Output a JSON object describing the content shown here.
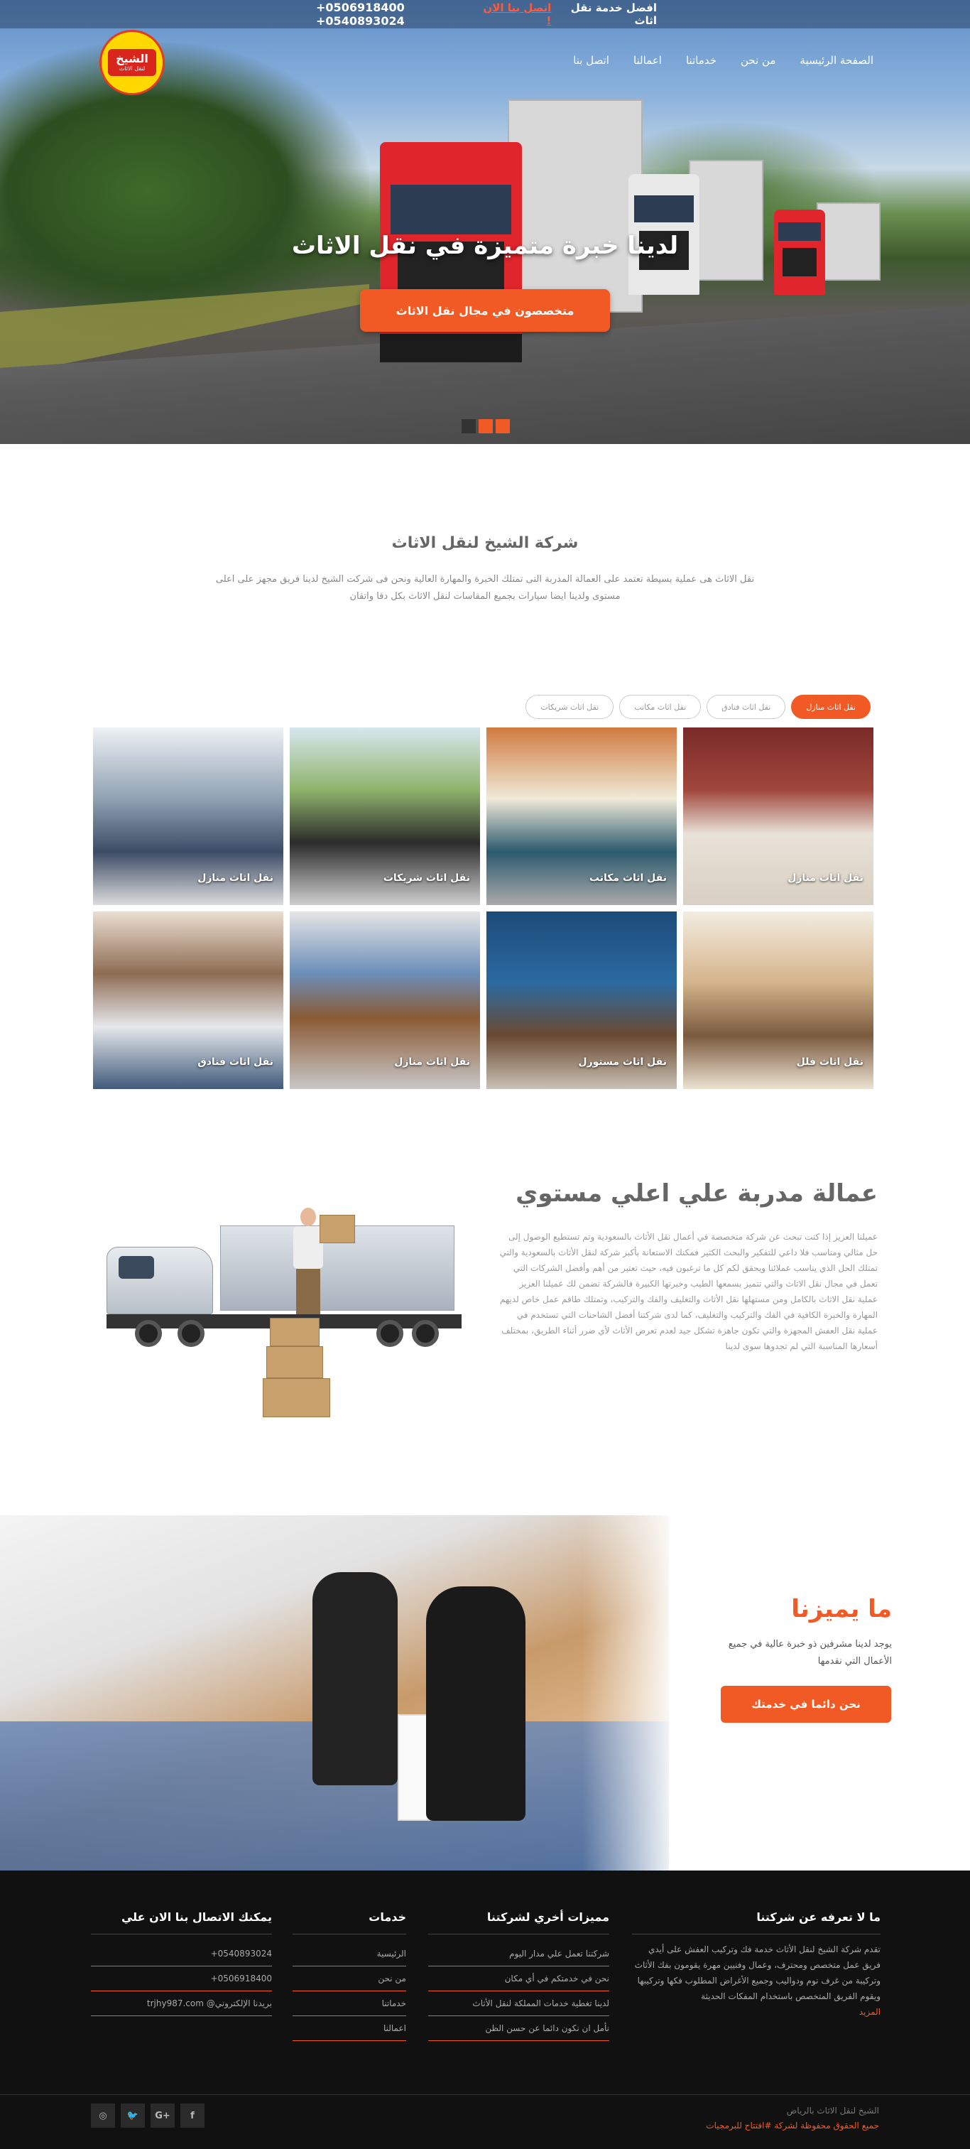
{
  "topbar": {
    "slogan": "افضل خدمة نقل اثاث",
    "call_label": "اتصل بنا الان !",
    "phones": "+0506918400 +0540893024"
  },
  "brand": {
    "name": "الشيخ",
    "subtitle": "لنقل الاثاث"
  },
  "nav": [
    {
      "label": "الصفحة الرئيسية"
    },
    {
      "label": "من نحن"
    },
    {
      "label": "خدماتنا"
    },
    {
      "label": "اعمالنا"
    },
    {
      "label": "اتصل بنا"
    }
  ],
  "hero": {
    "title": "لدينا خبرة متميزة في نقل الاثاث",
    "button": "متخصصون في مجال نقل الاثاث",
    "slides": 3,
    "active_slide": 1
  },
  "intro": {
    "title": "شركة الشيخ لنقل الاثاث",
    "text": "نقل الاثاث هى عملية بسيطة تعتمد على العمالة المدربة التى تمتلك الخبرة والمهارة العالية ونحن فى شركت الشيخ لدينا فريق مجهز على اعلى مستوى ولدينا ايضا سيارات بجميع المقاسات لنقل الاثاث بكل دقا واتقان"
  },
  "tabs": [
    {
      "label": "نقل اثاث منازل",
      "active": true
    },
    {
      "label": "نقل اثاث فنادق",
      "active": false
    },
    {
      "label": "نقل اثاث مكاتب",
      "active": false
    },
    {
      "label": "نقل اثاث شريكات",
      "active": false
    }
  ],
  "gallery": [
    {
      "caption": "نقل اثاث منازل"
    },
    {
      "caption": "نقل اثاث مكاتب"
    },
    {
      "caption": "نقل اثاث شريكات"
    },
    {
      "caption": "نقل اثاث منازل"
    },
    {
      "caption": "نقل اثاث فلل"
    },
    {
      "caption": "نقل اثاث مستورل"
    },
    {
      "caption": "نقل اثاث منازل"
    },
    {
      "caption": "نقل اثاث فنادق"
    }
  ],
  "workers": {
    "title": "عمالة مدربة علي اعلي مستوي",
    "text": "عميلنا العزيز إذا كنت تبحث عن شركة متخصصة في أعمال نقل الأثاث بالسعودية وتم تستطيع الوصول إلى حل مثالي ومناسب فلا داعي للتفكير والبحث الكثير فمكنك الاستعانة بأكبر شركة لنقل الأثاث بالسعودية والتي تمتلك الحل الذي يناسب عملائنا ويحقق لكم كل ما ترغبون فيه، حيث تعتبر من أهم وأفضل الشركات التي تعمل في مجال نقل الاثاث والتي تتميز بسمعها الطيب وخبرتها الكبيرة فالشركة تضمن لك عميلنا العزيز عملية نقل الاثاث بالكامل ومن مستهلها نقل الأثاث والتغليف والفك والتركيب، وتمتلك طاقم عمل خاص لديهم المهارة والخبرة الكافية في الفك والتركيب والتغليف، كما لدى شركتنا أفضل الشاحنات التي تستخدم في عملية نقل العفش المجهزة والتي تكون جاهزة تشكل جيد لعدم تعرض الأثاث لأي ضرر أثناء الطريق، بمختلف أسعارها المناسبة التي لم تجدوها سوى لدينا"
  },
  "features": {
    "title": "ما يميزنا",
    "text": "يوجد لدينا مشرفين ذو خبرة عالية في جميع الأعمال التي نقدمها",
    "button": "نحن دائما في خدمتك"
  },
  "footer": {
    "about": {
      "title": "ما لا تعرفه عن شركتنا",
      "text": "تقدم شركة الشيخ لنقل الأثاث خدمة فك وتركيب العفش على أيدي فريق عمل متخصص ومحترف، وعمال وفنيين مهرة يقومون بفك الأثاث وتركيبة من غرف نوم ودواليب وجميع الأغراض المطلوب فكها وتركيبها ويقوم الفريق المتخصص باستخدام المفكات الحديثة",
      "more": "المزيد"
    },
    "features": {
      "title": "مميزات أخري لشركتنا",
      "items": [
        "شركتنا تعمل علي مدار اليوم",
        "نحن في خدمتكم في أي مكان",
        "لدينا تغطية خدمات المملكة لنقل الأثاث",
        "نأمل ان نكون دائما عن حسن الظن"
      ]
    },
    "services": {
      "title": "خدمات",
      "items": [
        "الرئيسية",
        "من نحن",
        "خدماتنا",
        "اعمالنا"
      ]
    },
    "contact": {
      "title": "يمكنك الاتصال بنا الان علي",
      "items": [
        "0540893024+",
        "0506918400+",
        "بريدنا الإلكتروني@ trjhy987.com"
      ]
    },
    "copyright_1": "الشيخ لنقل الاثاث بالرياض",
    "copyright_2": "جميع الحقوق محفوظة لشركة #افتتاح للبرمجيات",
    "social": [
      {
        "icon": "facebook-icon",
        "glyph": "f"
      },
      {
        "icon": "google-plus-icon",
        "glyph": "G+"
      },
      {
        "icon": "twitter-icon",
        "glyph": "🐦"
      },
      {
        "icon": "instagram-icon",
        "glyph": "◎"
      }
    ]
  },
  "colors": {
    "accent": "#f15a24",
    "footer_bg": "#111111"
  }
}
